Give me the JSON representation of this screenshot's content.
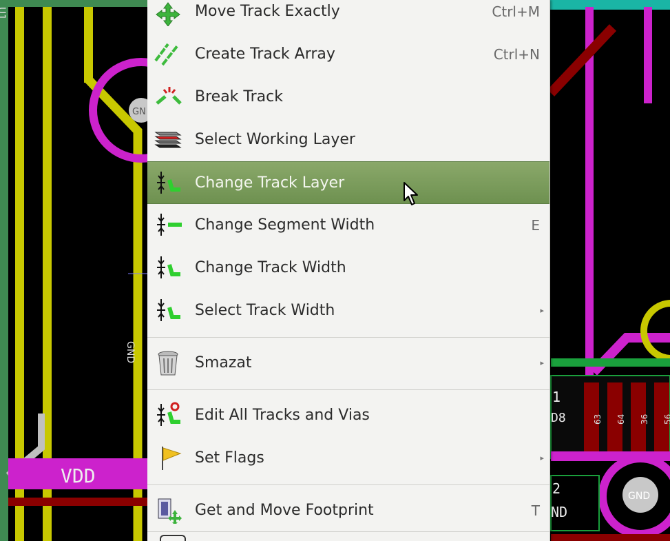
{
  "board": {
    "labels": {
      "vdd": "VDD",
      "gnd_left": "GN",
      "gnd_right": "GND",
      "gnd_vertical": "GND",
      "u_mark": "U1",
      "pin_1": "1",
      "pin_2": "2",
      "nd": "ND",
      "d8": "D8",
      "pad_63": "63",
      "pad_64": "64",
      "pad_36": "36",
      "pad_56": "56"
    },
    "colors": {
      "background": "#3f8a52",
      "canvas": "#000000",
      "track_yellow": "#c8c800",
      "track_magenta": "#cc22cc",
      "track_red": "#8a0000",
      "via_gray": "#c8c8c8",
      "silk_green": "#1aa03c",
      "teal": "#1ab5a5"
    }
  },
  "context_menu": {
    "items": [
      {
        "label": "Move Track Exactly",
        "shortcut": "Ctrl+M",
        "icon": "move-icon"
      },
      {
        "label": "Create Track Array",
        "shortcut": "Ctrl+N",
        "icon": "track-array-icon"
      },
      {
        "label": "Break Track",
        "shortcut": "",
        "icon": "break-track-icon"
      },
      {
        "label": "Select Working Layer",
        "shortcut": "",
        "icon": "layers-icon"
      },
      {
        "label": "Change Track Layer",
        "shortcut": "",
        "icon": "track-layer-icon",
        "highlighted": true
      },
      {
        "label": "Change Segment Width",
        "shortcut": "E",
        "icon": "segment-width-icon"
      },
      {
        "label": "Change Track Width",
        "shortcut": "",
        "icon": "track-width-icon"
      },
      {
        "label": "Select Track Width",
        "shortcut": "",
        "icon": "track-width-icon",
        "submenu": true
      },
      {
        "label": "Smazat",
        "shortcut": "",
        "icon": "trash-icon",
        "submenu": true
      },
      {
        "label": "Edit All Tracks and Vias",
        "shortcut": "",
        "icon": "edit-tracks-vias-icon"
      },
      {
        "label": "Set Flags",
        "shortcut": "",
        "icon": "flag-icon",
        "submenu": true
      },
      {
        "label": "Get and Move Footprint",
        "shortcut": "T",
        "icon": "footprint-move-icon"
      }
    ],
    "highlight_color": "#7a9a5c",
    "submenu_glyph": "▸"
  }
}
